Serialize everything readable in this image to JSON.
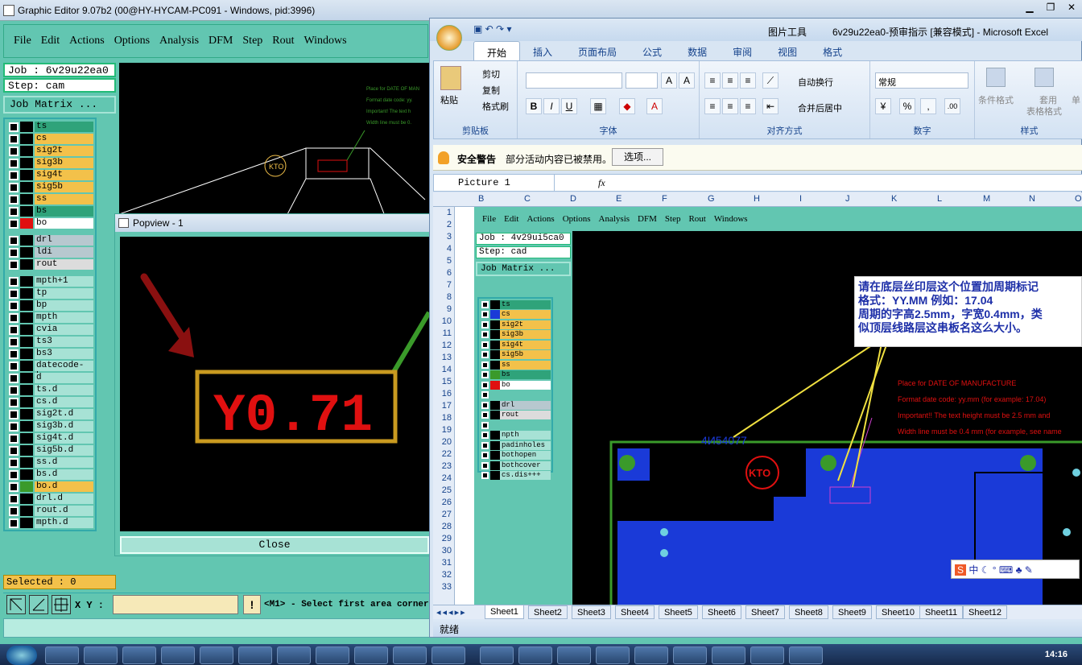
{
  "ge": {
    "title": "Graphic Editor 9.07b2 (00@HY-HYCAM-PC091 - Windows, pid:3996)",
    "menu": [
      "File",
      "Edit",
      "Actions",
      "Options",
      "Analysis",
      "DFM",
      "Step",
      "Rout",
      "Windows"
    ],
    "job": "Job : 6v29u22ea0",
    "step": "Step: cam",
    "job_matrix": "Job Matrix ...",
    "layers_group1": [
      {
        "name": "ts",
        "color": "#2fa37a",
        "sw": "#000"
      },
      {
        "name": "cs",
        "color": "#f3c14a",
        "sw": "#000"
      },
      {
        "name": "sig2t",
        "color": "#f3c14a",
        "sw": "#000"
      },
      {
        "name": "sig3b",
        "color": "#f3c14a",
        "sw": "#000"
      },
      {
        "name": "sig4t",
        "color": "#f3c14a",
        "sw": "#000"
      },
      {
        "name": "sig5b",
        "color": "#f3c14a",
        "sw": "#000"
      },
      {
        "name": "ss",
        "color": "#f3c14a",
        "sw": "#000"
      },
      {
        "name": "bs",
        "color": "#2fa37a",
        "sw": "#000"
      },
      {
        "name": "bo",
        "color": "#ffffff",
        "sw": "#e01010"
      }
    ],
    "layers_group2": [
      {
        "name": "drl",
        "color": "#b7c8cf",
        "sw": "#000"
      },
      {
        "name": "ldi",
        "color": "#b7c8cf",
        "sw": "#000"
      },
      {
        "name": "rout",
        "color": "#dcdcdc",
        "sw": "#000"
      }
    ],
    "layers_group3": [
      {
        "name": "mpth+1",
        "color": "#a7e2d5",
        "sw": "#000"
      },
      {
        "name": "tp",
        "color": "#a7e2d5",
        "sw": "#000"
      },
      {
        "name": "bp",
        "color": "#a7e2d5",
        "sw": "#000"
      },
      {
        "name": "mpth",
        "color": "#a7e2d5",
        "sw": "#000"
      },
      {
        "name": "cvia",
        "color": "#a7e2d5",
        "sw": "#000"
      },
      {
        "name": "ts3",
        "color": "#a7e2d5",
        "sw": "#000"
      },
      {
        "name": "bs3",
        "color": "#a7e2d5",
        "sw": "#000"
      },
      {
        "name": "datecode-bo",
        "color": "#a7e2d5",
        "sw": "#000"
      },
      {
        "name": "d",
        "color": "#a7e2d5",
        "sw": "#000"
      },
      {
        "name": "ts.d",
        "color": "#a7e2d5",
        "sw": "#000"
      },
      {
        "name": "cs.d",
        "color": "#a7e2d5",
        "sw": "#000"
      },
      {
        "name": "sig2t.d",
        "color": "#a7e2d5",
        "sw": "#000"
      },
      {
        "name": "sig3b.d",
        "color": "#a7e2d5",
        "sw": "#000"
      },
      {
        "name": "sig4t.d",
        "color": "#a7e2d5",
        "sw": "#000"
      },
      {
        "name": "sig5b.d",
        "color": "#a7e2d5",
        "sw": "#000"
      },
      {
        "name": "ss.d",
        "color": "#a7e2d5",
        "sw": "#000"
      },
      {
        "name": "bs.d",
        "color": "#a7e2d5",
        "sw": "#000"
      },
      {
        "name": "bo.d",
        "color": "#f3c14a",
        "sw": "#3a9a2a"
      },
      {
        "name": "drl.d",
        "color": "#a7e2d5",
        "sw": "#000"
      },
      {
        "name": "rout.d",
        "color": "#a7e2d5",
        "sw": "#000"
      },
      {
        "name": "mpth.d",
        "color": "#a7e2d5",
        "sw": "#000"
      }
    ],
    "canvas_notes": [
      "Place for DATE OF MAN",
      "Format date code: yy.",
      "Important! The text h",
      "Width line must be 0."
    ],
    "selected": "Selected : 0",
    "xy_label": "X Y :",
    "warn": "!",
    "status": "<M1> - Select first area corner"
  },
  "popview": {
    "title": "Popview - 1",
    "datecode": "Y0.71",
    "close": "Close"
  },
  "excel": {
    "title": "6v29u22ea0-预审指示  [兼容模式] - Microsoft Excel",
    "picture_tools": "图片工具",
    "tabs": [
      "开始",
      "插入",
      "页面布局",
      "公式",
      "数据",
      "审阅",
      "视图",
      "格式"
    ],
    "clipboard": {
      "paste": "粘贴",
      "cut": "剪切",
      "copy": "复制",
      "painter": "格式刷",
      "label": "剪贴板"
    },
    "font_label": "字体",
    "align_label": "对齐方式",
    "wrap": "自动换行",
    "merge": "合并后居中",
    "number_format": "常规",
    "number_label": "数字",
    "styles": {
      "cond": "条件格式",
      "table1": "套用",
      "table2": "表格格式",
      "label": "样式",
      "cell": "单"
    },
    "security": {
      "label": "安全警告",
      "msg": "部分活动内容已被禁用。",
      "options": "选项..."
    },
    "namebox": "Picture 1",
    "fx": "fx",
    "columns": [
      "B",
      "C",
      "D",
      "E",
      "F",
      "G",
      "H",
      "I",
      "J",
      "K",
      "L",
      "M",
      "N",
      "O"
    ],
    "rows": [
      "1",
      "2",
      "3",
      "4",
      "5",
      "6",
      "7",
      "8",
      "9",
      "10",
      "11",
      "12",
      "13",
      "14",
      "15",
      "16",
      "17",
      "18",
      "19",
      "20",
      "22",
      "23",
      "24",
      "25",
      "26",
      "27",
      "28",
      "29",
      "30",
      "31",
      "32",
      "33"
    ],
    "pic_menu": [
      "File",
      "Edit",
      "Actions",
      "Options",
      "Analysis",
      "DFM",
      "Step",
      "Rout",
      "Windows"
    ],
    "pic_job": "Job : 4v29ui5ca0",
    "pic_step": "Step: cad",
    "pic_job_matrix": "Job Matrix ...",
    "pic_layers": [
      {
        "name": "ts",
        "color": "#2fa37a",
        "sw": "#000"
      },
      {
        "name": "cs",
        "color": "#f3c14a",
        "sw": "#1a3ad8"
      },
      {
        "name": "sig2t",
        "color": "#f3c14a",
        "sw": "#000"
      },
      {
        "name": "sig3b",
        "color": "#f3c14a",
        "sw": "#000"
      },
      {
        "name": "sig4t",
        "color": "#f3c14a",
        "sw": "#000"
      },
      {
        "name": "sig5b",
        "color": "#f3c14a",
        "sw": "#000"
      },
      {
        "name": "ss",
        "color": "#f3c14a",
        "sw": "#000"
      },
      {
        "name": "bs",
        "color": "#2fa37a",
        "sw": "#3a9a2a"
      },
      {
        "name": "bo",
        "color": "#ffffff",
        "sw": "#e01010"
      },
      {
        "name": "",
        "color": "#62c6b1",
        "sw": "#62c6b1"
      },
      {
        "name": "drl",
        "color": "#b7c8cf",
        "sw": "#000"
      },
      {
        "name": "rout",
        "color": "#dcdcdc",
        "sw": "#000"
      },
      {
        "name": "",
        "color": "#62c6b1",
        "sw": "#62c6b1"
      },
      {
        "name": "npth",
        "color": "#a7e2d5",
        "sw": "#000"
      },
      {
        "name": "padinholes",
        "color": "#a7e2d5",
        "sw": "#000"
      },
      {
        "name": "bothopen",
        "color": "#a7e2d5",
        "sw": "#000"
      },
      {
        "name": "bothcover",
        "color": "#a7e2d5",
        "sw": "#000"
      },
      {
        "name": "cs.dis+++",
        "color": "#a7e2d5",
        "sw": "#000"
      }
    ],
    "note_text": [
      "请在底层丝印层这个位置加周期标记",
      "格式：YY.MM 例如：17.04",
      "周期的字高2.5mm，字宽0.4mm，类",
      "似顶层线路层这串板名这么大小。"
    ],
    "red_notes": [
      "Place for DATE OF MANUFACTURE",
      "Format date code: yy.mm (for example: 17.04)",
      "Important!! The text height must be 2.5 mm and",
      "Width line must be 0.4 mm (for example, see name"
    ],
    "board_name": "4И54077",
    "logo": "KTO",
    "sheets": [
      "Sheet1",
      "Sheet2",
      "Sheet3",
      "Sheet4",
      "Sheet5",
      "Sheet6",
      "Sheet7",
      "Sheet8",
      "Sheet9",
      "Sheet10",
      "Sheet11",
      "Sheet12"
    ],
    "status": "就绪"
  },
  "ime": {
    "text": "中"
  },
  "taskbar": {
    "clock": "14:16"
  },
  "colors": {
    "teal": "#62c6b1",
    "board_blue": "#1a3ad8",
    "note_blue": "#1d2fa8",
    "pad_green": "#3a9a2a"
  }
}
